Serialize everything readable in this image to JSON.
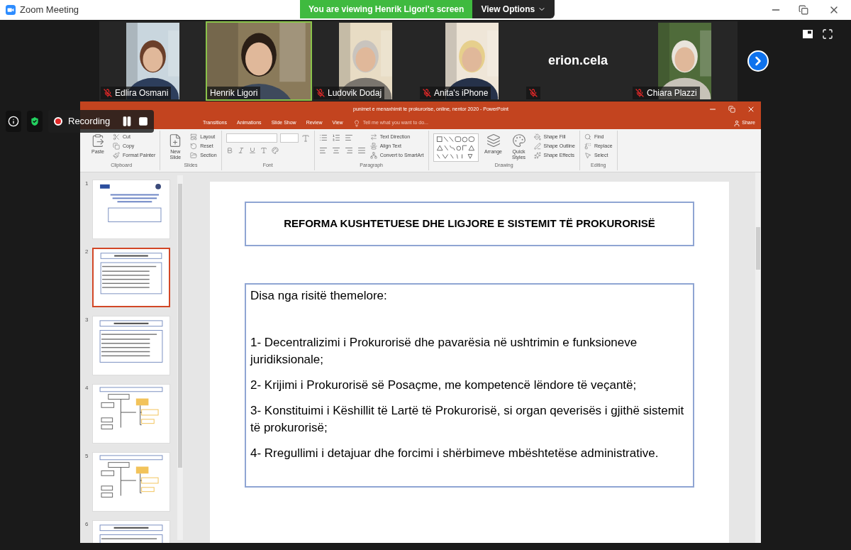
{
  "window": {
    "title": "Zoom Meeting"
  },
  "banner": {
    "text": "You are viewing Henrik Ligori's screen",
    "button": "View Options"
  },
  "participants": [
    {
      "name": "Edlira Osmani",
      "muted": true,
      "active": false,
      "kind": "video"
    },
    {
      "name": "Henrik Ligori",
      "muted": false,
      "active": true,
      "kind": "video"
    },
    {
      "name": "Ludovik Dodaj",
      "muted": true,
      "active": false,
      "kind": "video"
    },
    {
      "name": "Anita's iPhone",
      "muted": true,
      "active": false,
      "kind": "video"
    },
    {
      "name": "erion.cela",
      "muted": true,
      "active": false,
      "kind": "name"
    },
    {
      "name": "Chiara Plazzi",
      "muted": true,
      "active": false,
      "kind": "video"
    }
  ],
  "recording": {
    "label": "Recording"
  },
  "powerpoint": {
    "title": "punimet e menaxhimit te prokurorise, online, nentor 2020 - PowerPoint",
    "share": "Share",
    "tabs": [
      "Transitions",
      "Animations",
      "Slide Show",
      "Review",
      "View"
    ],
    "tell_me": "Tell me what you want to do...",
    "ribbon": [
      {
        "label": "Clipboard",
        "items": [
          {
            "kind": "large",
            "label": "Paste"
          },
          {
            "kind": "small",
            "label": "Cut"
          },
          {
            "kind": "small",
            "label": "Copy"
          },
          {
            "kind": "small",
            "label": "Format Painter"
          }
        ]
      },
      {
        "label": "Slides",
        "items": [
          {
            "kind": "large",
            "label": "New Slide"
          },
          {
            "kind": "small",
            "label": "Layout"
          },
          {
            "kind": "small",
            "label": "Reset"
          },
          {
            "kind": "small",
            "label": "Section"
          }
        ]
      },
      {
        "label": "Font",
        "items": [
          {
            "kind": "font"
          }
        ]
      },
      {
        "label": "Paragraph",
        "items": [
          {
            "kind": "paragraph"
          },
          {
            "kind": "small",
            "label": "Text Direction"
          },
          {
            "kind": "small",
            "label": "Align Text"
          },
          {
            "kind": "small",
            "label": "Convert to SmartArt"
          }
        ]
      },
      {
        "label": "Drawing",
        "items": [
          {
            "kind": "shapes"
          },
          {
            "kind": "large",
            "label": "Arrange"
          },
          {
            "kind": "large",
            "label": "Quick Styles"
          },
          {
            "kind": "small",
            "label": "Shape Fill"
          },
          {
            "kind": "small",
            "label": "Shape Outline"
          },
          {
            "kind": "small",
            "label": "Shape Effects"
          }
        ]
      },
      {
        "label": "Editing",
        "items": [
          {
            "kind": "small",
            "label": "Find"
          },
          {
            "kind": "small",
            "label": "Replace"
          },
          {
            "kind": "small",
            "label": "Select"
          }
        ]
      }
    ],
    "slides": [
      {
        "number": "1",
        "selected": false,
        "kind": "cover"
      },
      {
        "number": "2",
        "selected": true,
        "kind": "text"
      },
      {
        "number": "3",
        "selected": false,
        "kind": "text"
      },
      {
        "number": "4",
        "selected": false,
        "kind": "diagram"
      },
      {
        "number": "5",
        "selected": false,
        "kind": "diagram"
      },
      {
        "number": "6",
        "selected": false,
        "kind": "text"
      }
    ],
    "slide": {
      "title": "REFORMA KUSHTETUESE DHE LIGJORE E SISTEMIT TË PROKURORISË",
      "intro": "Disa nga risitë themelore:",
      "points": [
        "1- Decentralizimi i Prokurorisë dhe pavarësia në ushtrimin e funksioneve juridiksionale;",
        "2- Krijimi i Prokurorisë së Posaçme, me kompetencë lëndore të veçantë;",
        "3- Konstituimi i Këshillit të Lartë të Prokurorisë, si organ qeverisës i gjithë sistemit të prokurorisë;",
        "4- Rregullimi i detajuar dhe forcimi i shërbimeve mbështetëse administrative."
      ]
    }
  }
}
